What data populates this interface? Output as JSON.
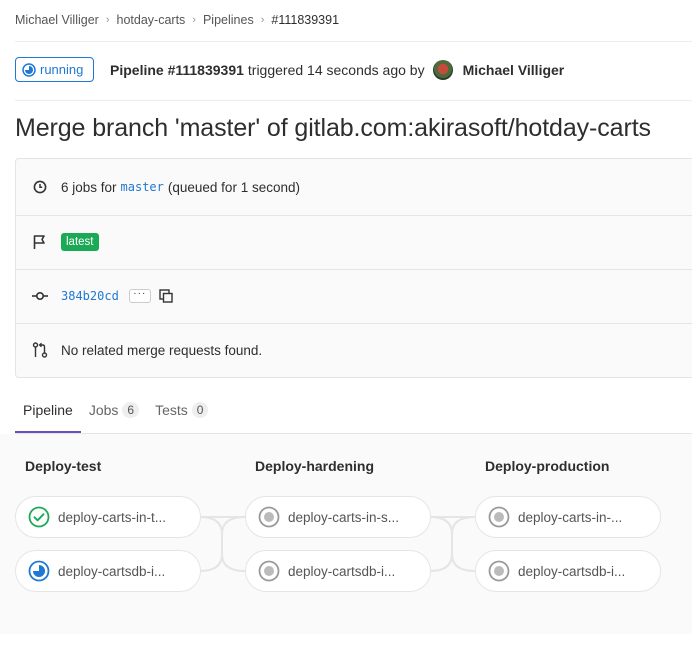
{
  "breadcrumb": [
    "Michael Villiger",
    "hotday-carts",
    "Pipelines",
    "#111839391"
  ],
  "header": {
    "status": "running",
    "pipeline_id": "Pipeline #111839391",
    "triggered_text": "triggered 14 seconds ago by",
    "author": "Michael Villiger"
  },
  "title": "Merge branch 'master' of gitlab.com:akirasoft/hotday-carts",
  "info": {
    "jobs_prefix": "6 jobs for",
    "branch": "master",
    "jobs_suffix": "(queued for 1 second)",
    "badge": "latest",
    "commit_sha": "384b20cd",
    "ellipsis": "···",
    "merge_requests": "No related merge requests found."
  },
  "tabs": [
    {
      "label": "Pipeline",
      "count": null,
      "active": true
    },
    {
      "label": "Jobs",
      "count": "6",
      "active": false
    },
    {
      "label": "Tests",
      "count": "0",
      "active": false
    }
  ],
  "stages": [
    {
      "name": "Deploy-test",
      "jobs": [
        {
          "name": "deploy-carts-in-t...",
          "status": "success"
        },
        {
          "name": "deploy-cartsdb-i...",
          "status": "running"
        }
      ]
    },
    {
      "name": "Deploy-hardening",
      "jobs": [
        {
          "name": "deploy-carts-in-s...",
          "status": "created"
        },
        {
          "name": "deploy-cartsdb-i...",
          "status": "created"
        }
      ]
    },
    {
      "name": "Deploy-production",
      "jobs": [
        {
          "name": "deploy-carts-in-...",
          "status": "created"
        },
        {
          "name": "deploy-cartsdb-i...",
          "status": "created"
        }
      ]
    }
  ],
  "colors": {
    "running": "#1f78d1",
    "success": "#1aaa55",
    "created": "#999999",
    "tab_active": "#6b4fbb"
  },
  "icons": [
    "clock-icon",
    "flag-icon",
    "commit-icon",
    "merge-request-icon",
    "copy-icon",
    "running-icon",
    "success-icon",
    "created-icon"
  ]
}
